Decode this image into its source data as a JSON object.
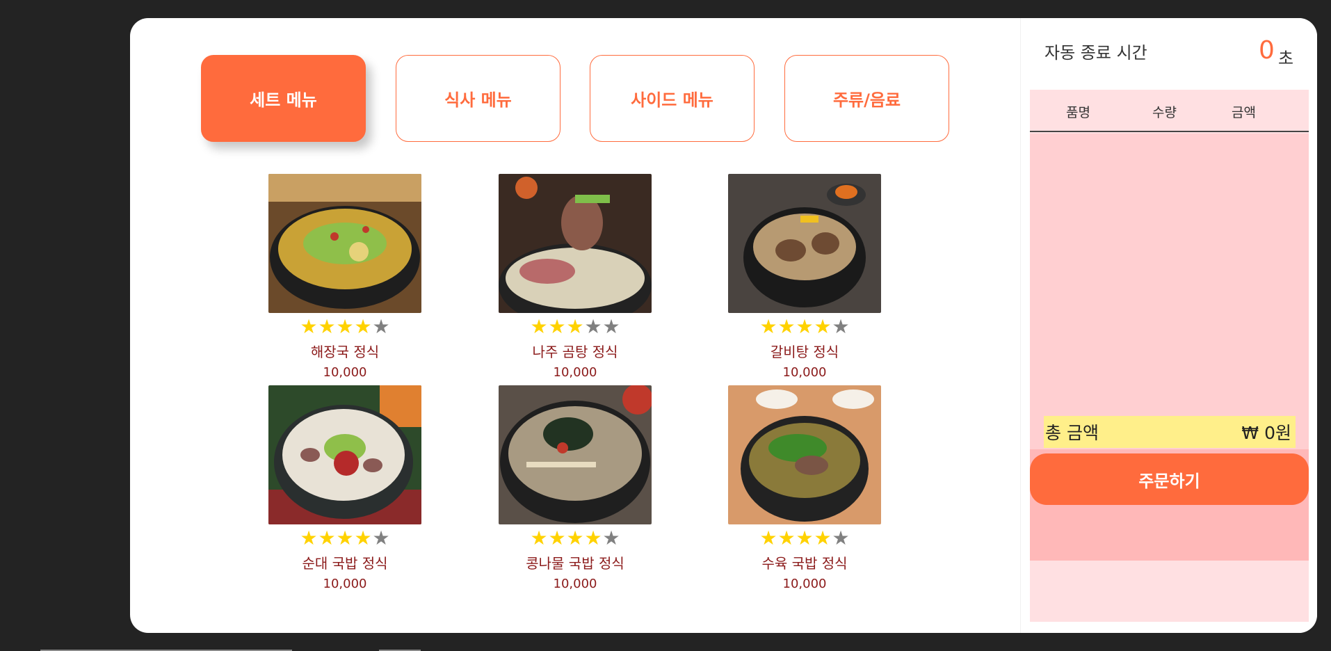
{
  "tabs": [
    {
      "label": "세트 메뉴",
      "active": true
    },
    {
      "label": "식사 메뉴",
      "active": false
    },
    {
      "label": "사이드 메뉴",
      "active": false
    },
    {
      "label": "주류/음료",
      "active": false
    }
  ],
  "menu_items": [
    {
      "name": "해장국 정식",
      "price": "10,000",
      "rating": 4
    },
    {
      "name": "나주 곰탕 정식",
      "price": "10,000",
      "rating": 3
    },
    {
      "name": "갈비탕 정식",
      "price": "10,000",
      "rating": 4
    },
    {
      "name": "순대 국밥 정식",
      "price": "10,000",
      "rating": 4
    },
    {
      "name": "콩나물 국밥 정식",
      "price": "10,000",
      "rating": 4
    },
    {
      "name": "수육 국밥 정식",
      "price": "10,000",
      "rating": 4
    }
  ],
  "order_panel": {
    "timer_label": "자동 종료 시간",
    "timer_value": "0",
    "timer_unit": "초",
    "columns": [
      "품명",
      "수량",
      "금액"
    ],
    "total_label": "총 금액",
    "total_value": "₩   0원",
    "order_button": "주문하기"
  },
  "colors": {
    "accent": "#ff6b3d",
    "star_on": "#ffd200",
    "star_off": "#808080",
    "text_dark_red": "#8b1a1a"
  }
}
